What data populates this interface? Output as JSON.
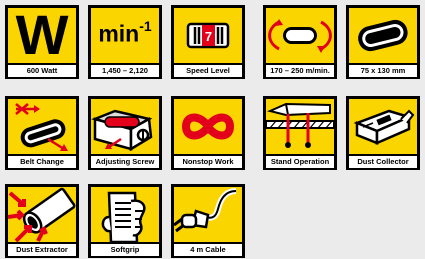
{
  "tiles": {
    "power": {
      "symbol": "W",
      "label": "600 Watt",
      "icon": "watt-icon"
    },
    "speed": {
      "unit": "min",
      "exponent": "-1",
      "label": "1,450 – 2,120",
      "icon": "rpm-icon"
    },
    "speed_level": {
      "dial_value": "7",
      "label": "Speed Level",
      "icon": "speed-dial-icon"
    },
    "belt_speed": {
      "label": "170 – 250 m/min.",
      "icon": "belt-speed-icon"
    },
    "belt_size": {
      "label": "75 x 130 mm",
      "icon": "sanding-belt-icon"
    },
    "belt_change": {
      "label": "Belt Change",
      "icon": "belt-change-icon"
    },
    "adjusting_screw": {
      "label": "Adjusting Screw",
      "icon": "adjusting-screw-icon"
    },
    "nonstop_work": {
      "label": "Nonstop Work",
      "icon": "infinity-icon"
    },
    "stand_operation": {
      "label": "Stand Operation",
      "icon": "stand-operation-icon"
    },
    "dust_collector": {
      "label": "Dust Collector",
      "icon": "dust-collector-icon"
    },
    "dust_extractor": {
      "label": "Dust Extractor",
      "icon": "dust-extractor-icon"
    },
    "softgrip": {
      "label": "Softgrip",
      "icon": "softgrip-icon"
    },
    "cable": {
      "label": "4 m Cable",
      "icon": "cable-plug-icon"
    }
  },
  "colors": {
    "tile_yellow": "#fbd500",
    "tile_border": "#000000",
    "accent_red": "#e3001b",
    "background": "#ebebeb"
  }
}
